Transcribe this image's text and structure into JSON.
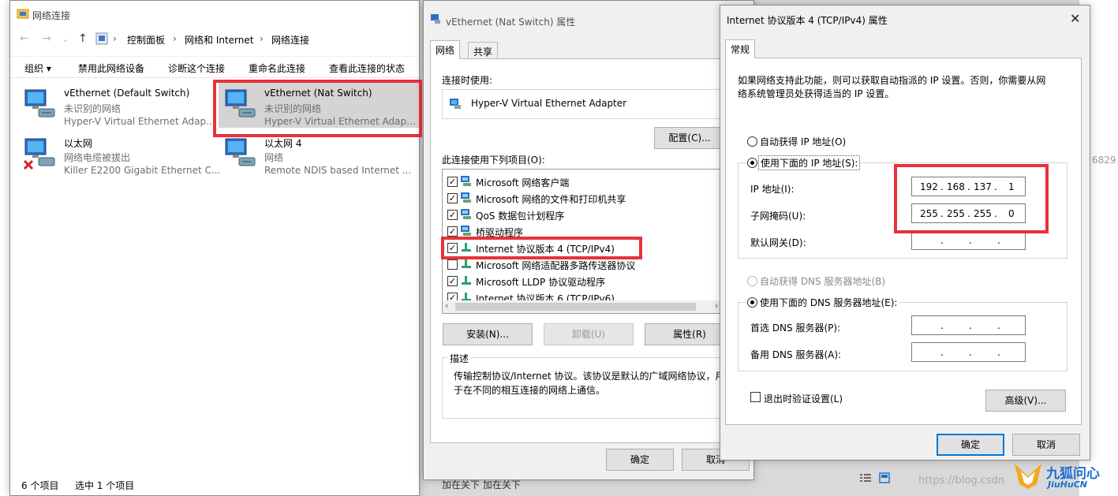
{
  "explorer": {
    "title": "网络连接",
    "breadcrumb": [
      "控制面板",
      "网络和 Internet",
      "网络连接"
    ],
    "commands": [
      "组织 ▾",
      "禁用此网络设备",
      "诊断这个连接",
      "重命名此连接",
      "查看此连接的状态"
    ],
    "items": [
      {
        "name": "vEthernet (Default Switch)",
        "status": "未识别的网络",
        "adapter": "Hyper-V Virtual Ethernet Adap..."
      },
      {
        "name": "vEthernet (Nat Switch)",
        "status": "未识别的网络",
        "adapter": "Hyper-V Virtual Ethernet Adap..."
      },
      {
        "name": "以太网",
        "status": "网络电缆被拔出",
        "adapter": "Killer E2200 Gigabit Ethernet C..."
      },
      {
        "name": "以太网 4",
        "status": "网络",
        "adapter": "Remote NDIS based Internet ..."
      }
    ],
    "status_count": "6 个项目",
    "status_selected": "选中 1 个项目"
  },
  "props": {
    "title": "vEthernet (Nat Switch) 属性",
    "tabs": [
      "网络",
      "共享"
    ],
    "connect_using_label": "连接时使用:",
    "adapter_name": "Hyper-V Virtual Ethernet Adapter",
    "configure_label": "配置(C)...",
    "items_label": "此连接使用下列项目(O):",
    "items": [
      {
        "label": "Microsoft 网络客户端",
        "checked": true
      },
      {
        "label": "Microsoft 网络的文件和打印机共享",
        "checked": true
      },
      {
        "label": "QoS 数据包计划程序",
        "checked": true
      },
      {
        "label": "桥驱动程序",
        "checked": true
      },
      {
        "label": "Internet 协议版本 4 (TCP/IPv4)",
        "checked": true
      },
      {
        "label": "Microsoft 网络适配器多路传送器协议",
        "checked": false
      },
      {
        "label": "Microsoft LLDP 协议驱动程序",
        "checked": true
      },
      {
        "label": "Internet 协议版本 6 (TCP/IPv6)",
        "checked": true
      }
    ],
    "install_label": "安装(N)...",
    "uninstall_label": "卸载(U)",
    "properties_label": "属性(R)",
    "description_label": "描述",
    "description_text_1": "传输控制协议/Internet 协议。该协议是默认的广域网络协议，用",
    "description_text_2": "于在不同的相互连接的网络上通信。",
    "ok_label": "确定",
    "cancel_label": "取消"
  },
  "ipv4": {
    "title": "Internet 协议版本 4 (TCP/IPv4) 属性",
    "tab": "常规",
    "intro_1": "如果网络支持此功能，则可以获取自动指派的 IP 设置。否则，你需要从网",
    "intro_2": "络系统管理员处获得适当的 IP 设置。",
    "auto_ip_label": "自动获得 IP 地址(O)",
    "manual_ip_label": "使用下面的 IP 地址(S):",
    "ip_label": "IP 地址(I):",
    "ip_octets": [
      "192",
      "168",
      "137",
      "1"
    ],
    "mask_label": "子网掩码(U):",
    "mask_octets": [
      "255",
      "255",
      "255",
      "0"
    ],
    "gateway_label": "默认网关(D):",
    "auto_dns_label": "自动获得 DNS 服务器地址(B)",
    "manual_dns_label": "使用下面的 DNS 服务器地址(E):",
    "preferred_dns_label": "首选 DNS 服务器(P):",
    "alternate_dns_label": "备用 DNS 服务器(A):",
    "validate_label": "退出时验证设置(L)",
    "advanced_label": "高级(V)...",
    "ok_label": "确定",
    "cancel_label": "取消",
    "dot": "."
  },
  "watermark": "https://blog.csdn",
  "logo": {
    "cn": "九狐问心",
    "en": "JiuHuCN"
  },
  "background_fragments": {
    "bottom": "加在关下 加在关下",
    "right_num": "6829"
  },
  "colors": {
    "highlight": "#e8313a",
    "selection": "#cce8ff",
    "accent": "#0078d7"
  }
}
